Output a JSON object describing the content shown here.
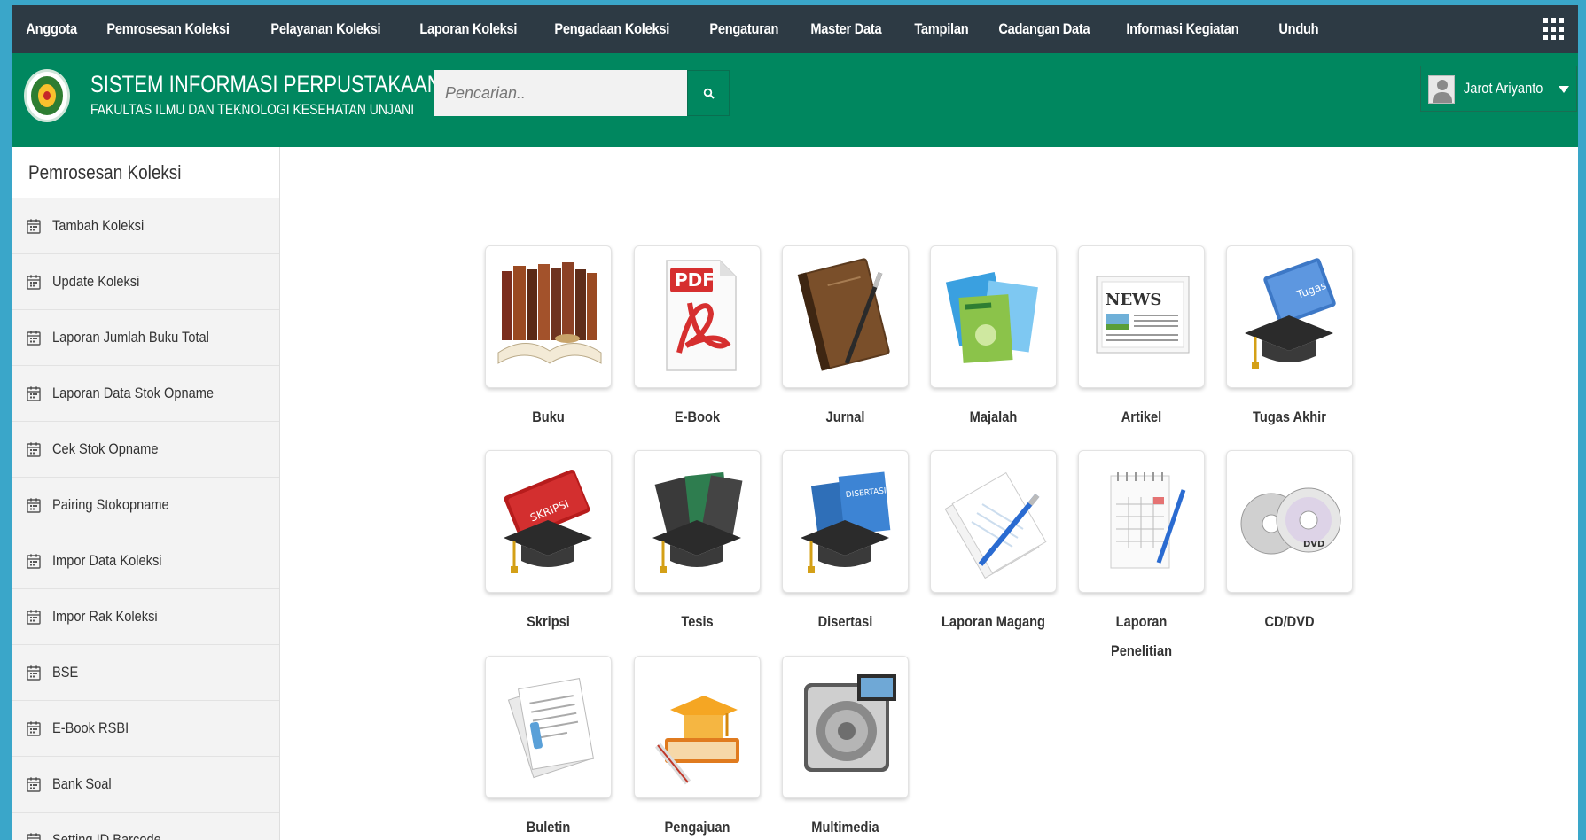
{
  "topnav": {
    "items": [
      "Anggota",
      "Pemrosesan Koleksi",
      "Pelayanan Koleksi",
      "Laporan Koleksi",
      "Pengadaan Koleksi",
      "Pengaturan",
      "Master Data",
      "Tampilan",
      "Cadangan Data",
      "Informasi Kegiatan",
      "Unduh"
    ]
  },
  "header": {
    "title": "SISTEM INFORMASI PERPUSTAKAAN",
    "subtitle": "FAKULTAS ILMU DAN TEKNOLOGI KESEHATAN UNJANI",
    "search_placeholder": "Pencarian..",
    "user_name": "Jarot Ariyanto"
  },
  "sidebar": {
    "title": "Pemrosesan Koleksi",
    "items": [
      "Tambah Koleksi",
      "Update Koleksi",
      "Laporan Jumlah Buku Total",
      "Laporan Data Stok Opname",
      "Cek Stok Opname",
      "Pairing Stokopname",
      "Impor Data Koleksi",
      "Impor Rak Koleksi",
      "BSE",
      "E-Book RSBI",
      "Bank Soal",
      "Setting ID Barcode"
    ]
  },
  "tiles": [
    {
      "label": "Buku",
      "icon": "books-icon"
    },
    {
      "label": "E-Book",
      "icon": "pdf-icon"
    },
    {
      "label": "Jurnal",
      "icon": "journal-icon"
    },
    {
      "label": "Majalah",
      "icon": "magazine-icon"
    },
    {
      "label": "Artikel",
      "icon": "newspaper-icon"
    },
    {
      "label": "Tugas Akhir",
      "icon": "graduation-book-icon"
    },
    {
      "label": "Skripsi",
      "icon": "skripsi-icon"
    },
    {
      "label": "Tesis",
      "icon": "tesis-icon"
    },
    {
      "label": "Disertasi",
      "icon": "disertasi-icon"
    },
    {
      "label": "Laporan Magang",
      "icon": "pen-paper-icon"
    },
    {
      "label": "Laporan Penelitian",
      "icon": "notepad-icon"
    },
    {
      "label": "CD/DVD",
      "icon": "disc-icon"
    },
    {
      "label": "Buletin",
      "icon": "document-icon"
    },
    {
      "label": "Pengajuan",
      "icon": "scholar-icon"
    },
    {
      "label": "Multimedia",
      "icon": "speaker-icon"
    }
  ]
}
